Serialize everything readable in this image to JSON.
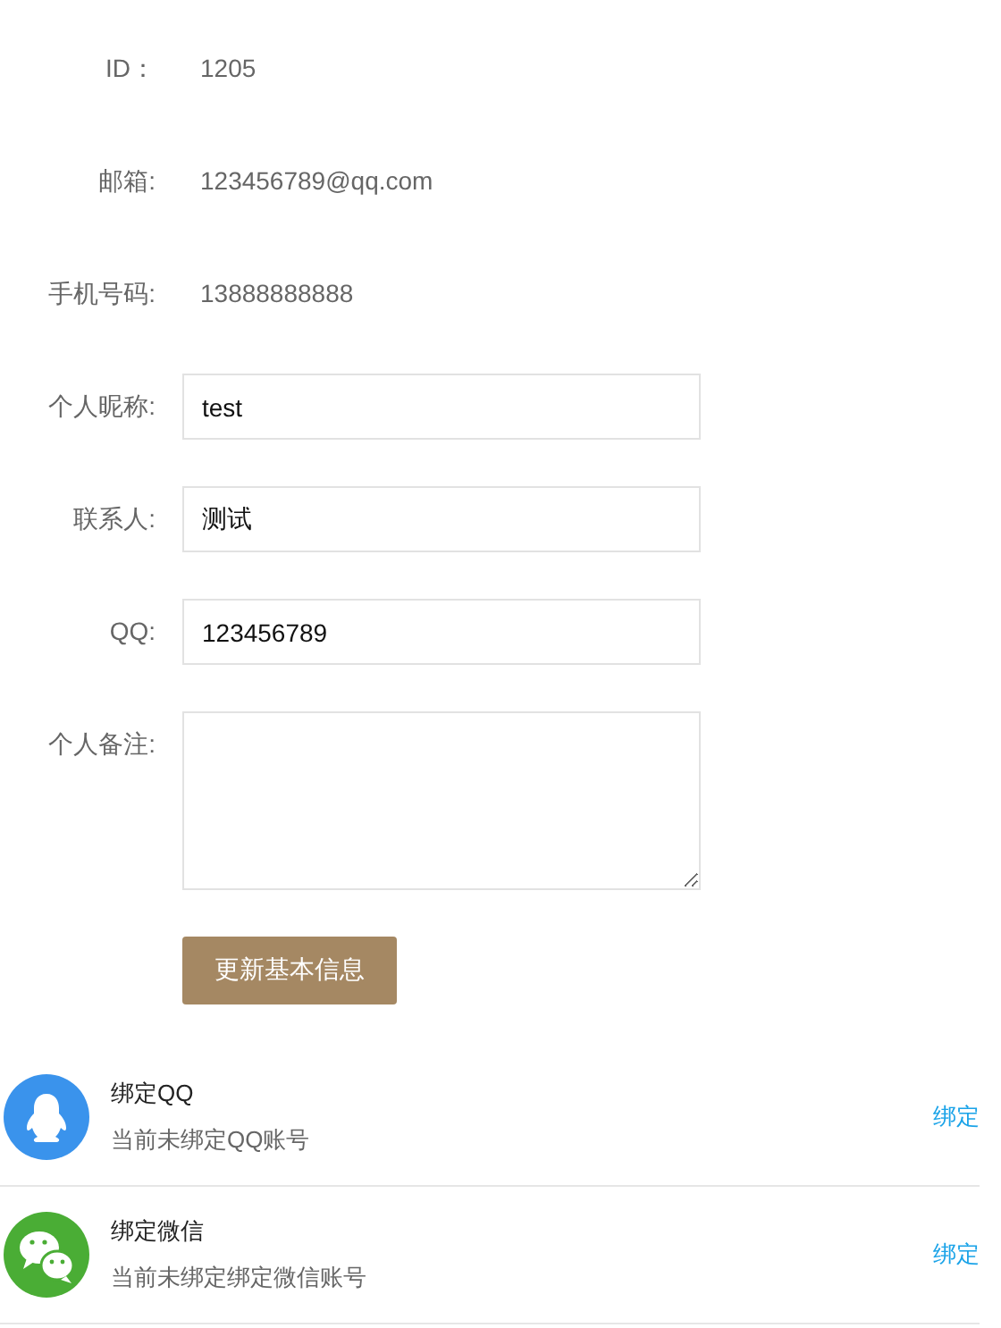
{
  "fields": [
    {
      "kind": "text",
      "label": "ID：",
      "value": "1205"
    },
    {
      "kind": "text",
      "label": "邮箱:",
      "value": "123456789@qq.com"
    },
    {
      "kind": "text",
      "label": "手机号码:",
      "value": "13888888888"
    },
    {
      "kind": "input",
      "label": "个人昵称:",
      "value": "test"
    },
    {
      "kind": "input",
      "label": "联系人:",
      "value": "测试"
    },
    {
      "kind": "input",
      "label": "QQ:",
      "value": "123456789"
    },
    {
      "kind": "textarea",
      "label": "个人备注:"
    }
  ],
  "submit_button": "更新基本信息",
  "bindings": [
    {
      "kind": "qq",
      "title": "绑定QQ",
      "description": "当前未绑定QQ账号",
      "action": "绑定"
    },
    {
      "kind": "wechat",
      "title": "绑定微信",
      "description": "当前未绑定绑定微信账号",
      "action": "绑定"
    }
  ]
}
